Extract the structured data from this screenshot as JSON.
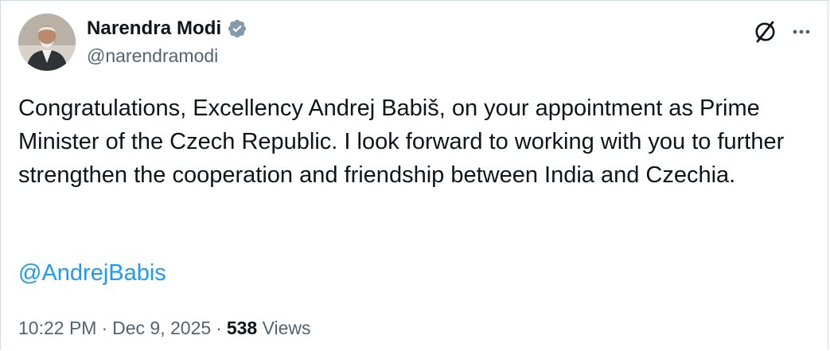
{
  "author": {
    "name": "Narendra Modi",
    "handle": "@narendramodi",
    "verified": true
  },
  "icons": {
    "avatar": "profile-photo",
    "verified": "verified-badge-icon",
    "grok": "grok-icon",
    "more": "more-options-icon"
  },
  "colors": {
    "text": "#0f1419",
    "secondary": "#536471",
    "link": "#1d9bf0",
    "verified_badge": "#829aab"
  },
  "tweet": {
    "text": "Congratulations, Excellency Andrej Babiš, on your appointment as Prime Minister of the Czech Republic. I look forward to working with you to further strengthen the cooperation and friendship between India and Czechia.",
    "mention": "@AndrejBabis"
  },
  "meta": {
    "time": "10:22 PM",
    "separator": "·",
    "date": "Dec 9, 2025",
    "views_count": "538",
    "views_label": "Views"
  }
}
